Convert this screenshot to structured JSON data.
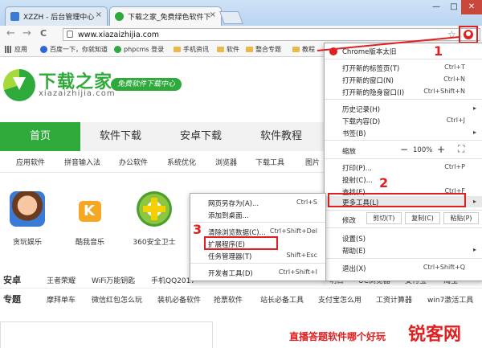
{
  "colors": {
    "accent_green": "#2eaa3b",
    "red": "#e02020",
    "chrome_tab": "#dfe9f4",
    "nav_bg": "#f2f2f2"
  },
  "tabs": [
    {
      "title": "XZZH - 后台管理中心",
      "close": "×"
    },
    {
      "title": "下载之家_免费绿色软件下",
      "close": "×"
    }
  ],
  "window_buttons": {
    "minimize": "—",
    "maximize": "□",
    "close": "✕"
  },
  "toolbar": {
    "back": "←",
    "forward": "→",
    "reload": "C",
    "url": "www.xiazaizhijia.com",
    "star": "☆"
  },
  "bookmarks": [
    {
      "label": "应用",
      "icon": "apps-icon"
    },
    {
      "label": "百度一下，你就知道",
      "icon": "baidu-icon"
    },
    {
      "label": "phpcms 登录",
      "icon": "phpcms-icon"
    },
    {
      "label": "手机资讯",
      "icon": "folder-icon"
    },
    {
      "label": "软件",
      "icon": "folder-icon"
    },
    {
      "label": "整合专题",
      "icon": "folder-icon"
    },
    {
      "label": "教程",
      "icon": "folder-icon"
    }
  ],
  "site": {
    "logo_cn": "下载之家",
    "logo_en": "xiazaizhijia.com",
    "slogan": "免费软件下载中心",
    "nav": [
      "首页",
      "软件下载",
      "安卓下载",
      "软件教程"
    ],
    "subnav": [
      "应用软件",
      "拼音输入法",
      "办公软件",
      "系统优化",
      "浏览器",
      "下载工具",
      "图片"
    ],
    "apps": [
      "贪玩娱乐",
      "酷我音乐",
      "360安全卫士"
    ],
    "row_anzhuo": {
      "label": "安卓",
      "items": [
        "王者荣耀",
        "WiFi万能钥匙",
        "手机QQ2017",
        "明日",
        "UC浏览器",
        "支付宝",
        "淘宝"
      ]
    },
    "row_zhuanti": {
      "label": "专题",
      "items": [
        "摩拜单车",
        "微信红包怎么玩",
        "装机必备软件",
        "抢票软件",
        "站长必备工具",
        "支付宝怎么用",
        "工资计算器",
        "win7激活工具"
      ]
    },
    "footer_note": "直播答题软件哪个好玩",
    "watermark": "锐客网"
  },
  "chrome_menu": {
    "header": "Chrome版本太旧",
    "items": [
      {
        "label": "打开新的标签页(T)",
        "shortcut": "Ctrl+T"
      },
      {
        "label": "打开新的窗口(N)",
        "shortcut": "Ctrl+N"
      },
      {
        "label": "打开新的隐身窗口(I)",
        "shortcut": "Ctrl+Shift+N"
      },
      {
        "label": "历史记录(H)",
        "shortcut": "▸"
      },
      {
        "label": "下载内容(D)",
        "shortcut": "Ctrl+J"
      },
      {
        "label": "书签(B)",
        "shortcut": "▸"
      },
      {
        "label": "打印(P)...",
        "shortcut": "Ctrl+P"
      },
      {
        "label": "投射(C)...",
        "shortcut": ""
      },
      {
        "label": "查找(F)...",
        "shortcut": "Ctrl+F"
      },
      {
        "label": "更多工具(L)",
        "shortcut": "▸"
      },
      {
        "label": "设置(S)",
        "shortcut": ""
      },
      {
        "label": "帮助(E)",
        "shortcut": "▸"
      },
      {
        "label": "退出(X)",
        "shortcut": "Ctrl+Shift+Q"
      }
    ],
    "zoom": {
      "label": "缩放",
      "minus": "−",
      "value": "100%",
      "plus": "+",
      "fullscreen": "⛶"
    },
    "edit": {
      "label": "修改",
      "cut": "剪切(T)",
      "copy": "复制(C)",
      "paste": "粘贴(P)"
    }
  },
  "more_tools_menu": {
    "items": [
      {
        "label": "网页另存为(A)...",
        "shortcut": "Ctrl+S"
      },
      {
        "label": "添加到桌面...",
        "shortcut": ""
      },
      {
        "label": "清除浏览数据(C)...",
        "shortcut": "Ctrl+Shift+Del"
      },
      {
        "label": "扩展程序(E)",
        "shortcut": ""
      },
      {
        "label": "任务管理器(T)",
        "shortcut": "Shift+Esc"
      },
      {
        "label": "开发者工具(D)",
        "shortcut": "Ctrl+Shift+I"
      }
    ]
  },
  "annotations": {
    "step1": "1",
    "step2": "2",
    "step3": "3"
  }
}
